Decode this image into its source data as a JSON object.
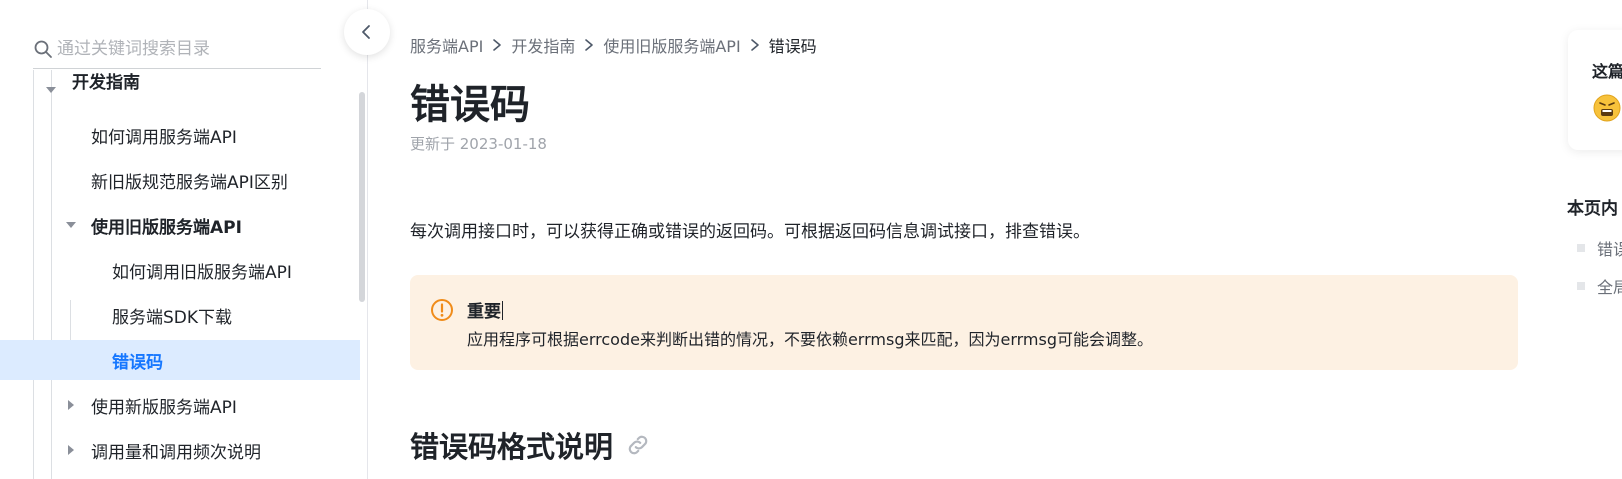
{
  "sidebar": {
    "search_placeholder": "通过关键词搜索目录",
    "items": [
      {
        "label": "开发指南"
      },
      {
        "label": "如何调用服务端API"
      },
      {
        "label": "新旧版规范服务端API区别"
      },
      {
        "label": "使用旧版服务端API"
      },
      {
        "label": "如何调用旧版服务端API"
      },
      {
        "label": "服务端SDK下载"
      },
      {
        "label": "错误码"
      },
      {
        "label": "使用新版服务端API"
      },
      {
        "label": "调用量和调用频次说明"
      }
    ]
  },
  "breadcrumb": {
    "items": [
      "服务端API",
      "开发指南",
      "使用旧版服务端API"
    ],
    "current": "错误码"
  },
  "article": {
    "title": "错误码",
    "updated": "更新于 2023-01-18",
    "intro": "每次调用接口时，可以获得正确或错误的返回码。可根据返回码信息调试接口，排查错误。",
    "callout": {
      "title": "重要",
      "body": "应用程序可根据errcode来判断出错的情况，不要依赖errmsg来匹配，因为errmsg可能会调整。"
    },
    "section_title": "错误码格式说明"
  },
  "feedback": {
    "title": "这篇"
  },
  "toc": {
    "title": "本页内",
    "items": [
      {
        "label": "错误"
      },
      {
        "label": "全局"
      }
    ]
  },
  "colors": {
    "accent": "#1677ff",
    "active_bg": "#dcebff",
    "callout_bg": "#fdf1e3",
    "warning": "#f08c1a"
  }
}
